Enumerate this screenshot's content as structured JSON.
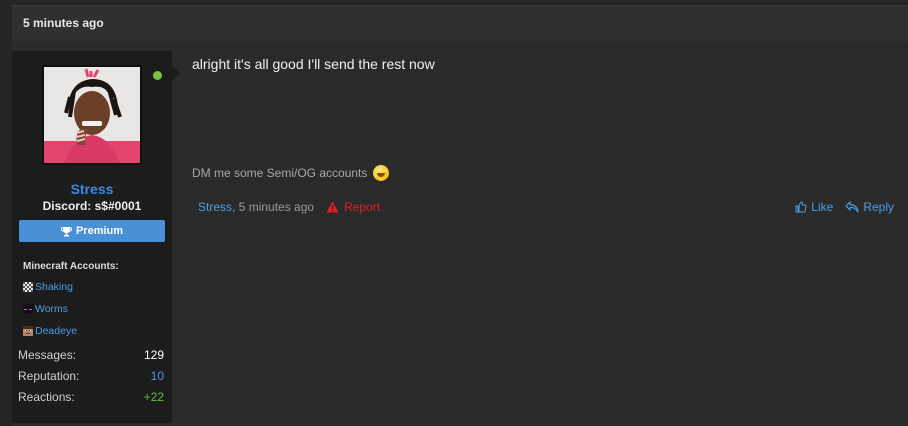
{
  "header": {
    "timestamp": "5 minutes ago"
  },
  "user": {
    "name": "Stress",
    "title": "Discord: s$#0001",
    "badge": "Premium",
    "online": true,
    "minecraft_title": "Minecraft Accounts:",
    "minecraft_accounts": [
      {
        "name": "Shaking",
        "icon": "checker-skin-icon"
      },
      {
        "name": "Worms",
        "icon": "enderman-skin-icon"
      },
      {
        "name": "Deadeye",
        "icon": "steve-skin-icon"
      }
    ],
    "stats": [
      {
        "label": "Messages:",
        "value": "129",
        "color": "#ffffff"
      },
      {
        "label": "Reputation:",
        "value": "10",
        "color": "#4a9ee8"
      },
      {
        "label": "Reactions:",
        "value": "+22",
        "color": "#5cc13b"
      }
    ]
  },
  "post": {
    "message": "alright it's all good I'll send the rest now",
    "signature": "DM me some Semi/OG accounts",
    "author": "Stress",
    "time": ", 5 minutes ago",
    "report_label": "Report",
    "like_label": "Like",
    "reply_label": "Reply"
  },
  "colors": {
    "accent": "#3a8be0",
    "premium": "#4a90d4",
    "online": "#7ac142",
    "report": "#e02020"
  }
}
